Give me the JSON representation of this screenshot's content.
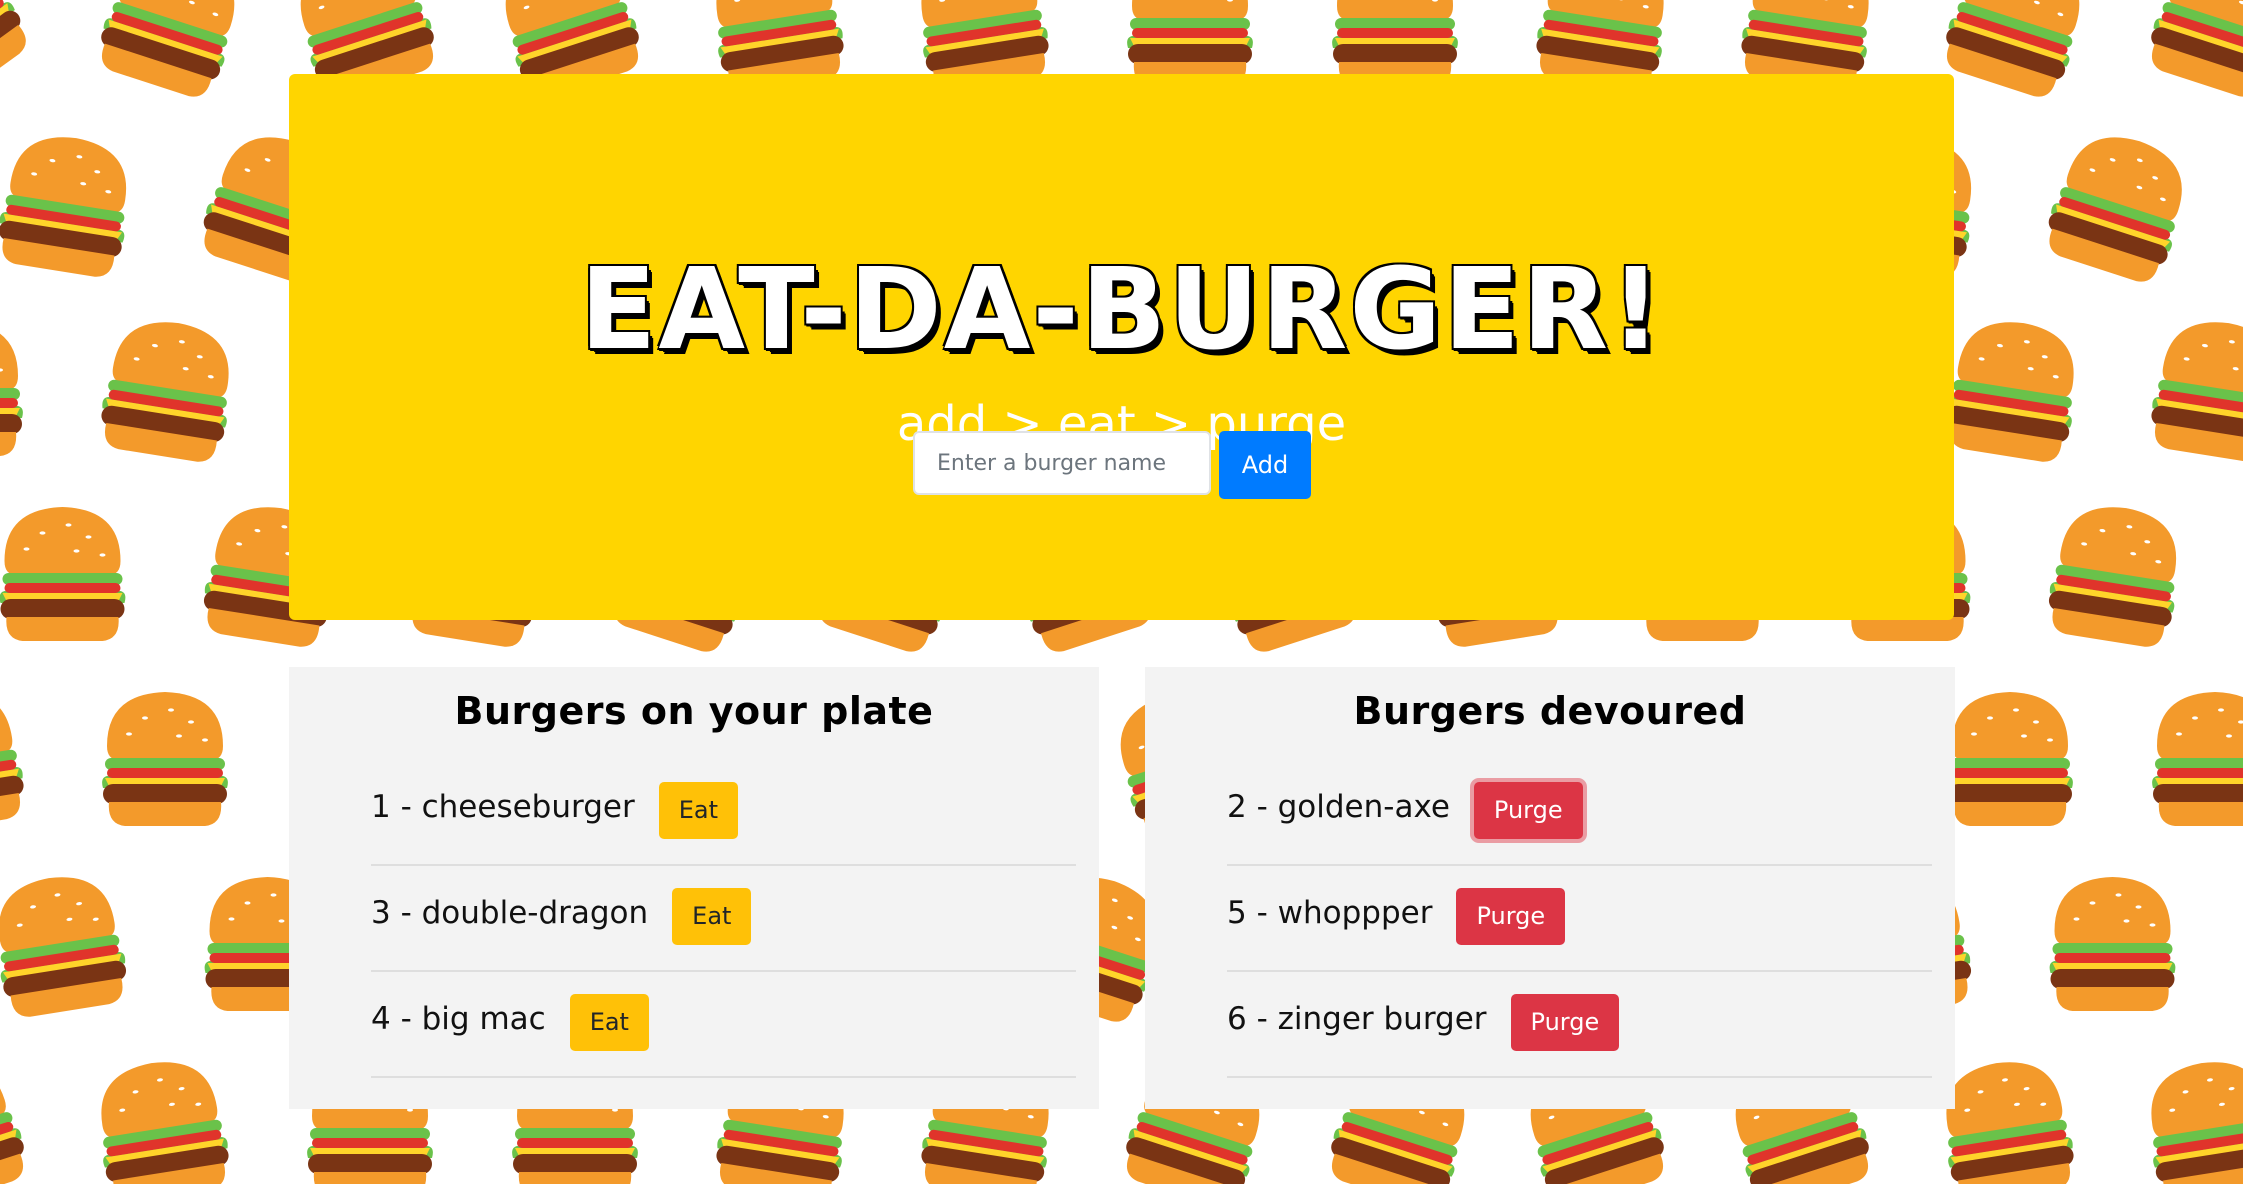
{
  "header": {
    "title": "EAT-DA-BURGER!",
    "subtitle": "add > eat > purge"
  },
  "form": {
    "placeholder": "Enter a burger name",
    "value": "",
    "add_label": "Add"
  },
  "uneaten": {
    "heading": "Burgers on your plate",
    "items": [
      {
        "text": "1 - cheeseburger",
        "button": "Eat"
      },
      {
        "text": "3 - double-dragon",
        "button": "Eat"
      },
      {
        "text": "4 - big mac",
        "button": "Eat"
      }
    ]
  },
  "devoured": {
    "heading": "Burgers devoured",
    "items": [
      {
        "text": "2 - golden-axe",
        "button": "Purge"
      },
      {
        "text": "5 - whoppper",
        "button": "Purge"
      },
      {
        "text": "6 - zinger burger",
        "button": "Purge"
      }
    ]
  },
  "colors": {
    "jumbotron": "#ffd500",
    "add_button": "#007bff",
    "eat_button": "#ffc107",
    "purge_button": "#dc3545",
    "panel": "#f3f3f3"
  },
  "icons": {
    "background": "burger-pattern"
  }
}
